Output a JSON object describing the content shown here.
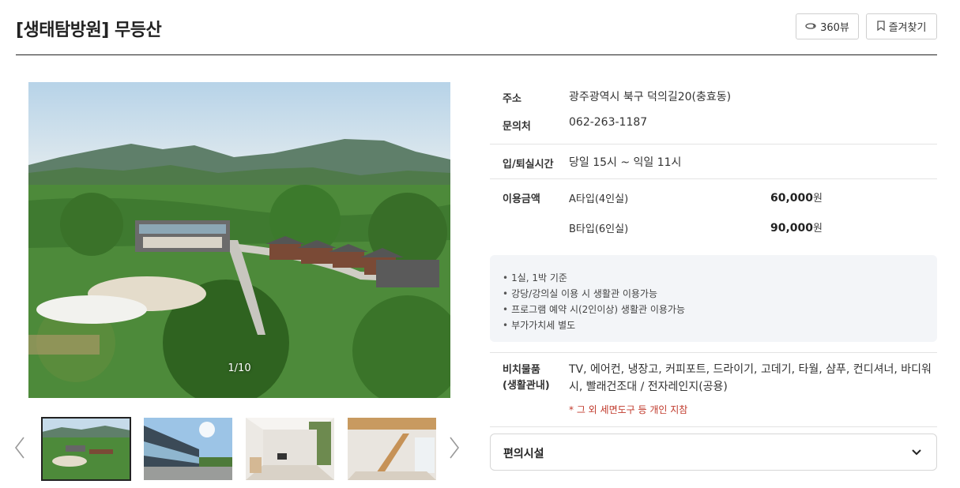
{
  "header": {
    "title": "[생태탐방원] 무등산",
    "btn_360": "360뷰",
    "btn_fav": "즐겨찾기"
  },
  "gallery": {
    "counter": "1/10",
    "prev_icon": "chevron-left-icon",
    "next_icon": "chevron-right-icon"
  },
  "info": {
    "address_label": "주소",
    "address": "광주광역시 북구 덕의길20(충효동)",
    "contact_label": "문의처",
    "contact": "062-263-1187",
    "checkin_label": "입/퇴실시간",
    "checkin": "당일 15시 ~ 익일 11시",
    "price_label": "이용금액",
    "prices": [
      {
        "type": "A타입(4인실)",
        "amount": "60,000",
        "unit": "원"
      },
      {
        "type": "B타입(6인실)",
        "amount": "90,000",
        "unit": "원"
      }
    ]
  },
  "notes": [
    "1실, 1박 기준",
    "강당/강의실 이용 시 생활관 이용가능",
    "프로그램 예약 시(2인이상) 생활관 이용가능",
    "부가가치세 별도"
  ],
  "amenities": {
    "label_line1": "비치물품",
    "label_line2": "(생활관내)",
    "text": "TV, 에어컨, 냉장고, 커피포트, 드라이기, 고데기, 타월, 샴푸, 컨디셔너, 바디워시, 빨래건조대 / 전자레인지(공용)",
    "note": "* 그 외 세면도구 등 개인 지참"
  },
  "facility": {
    "label": "편의시설"
  }
}
